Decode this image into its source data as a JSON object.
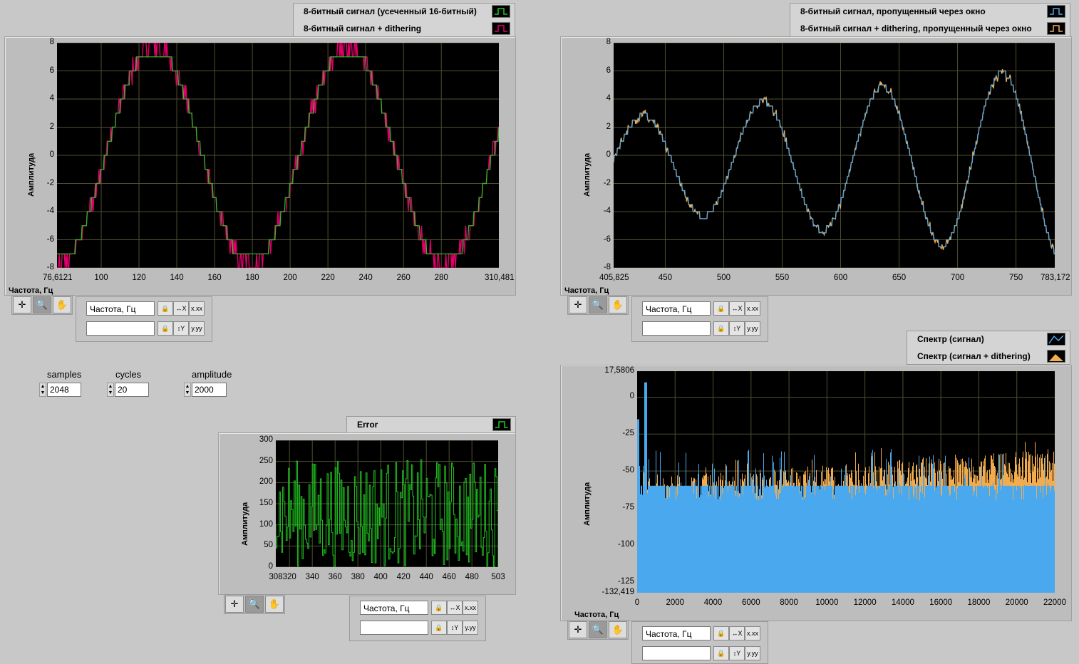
{
  "colors": {
    "dig8": "#22c522",
    "dither": "#e0006a",
    "win": "#4aa8ee",
    "win_dither": "#f2ac4e",
    "err": "#22c522",
    "grid": "#4f4f33"
  },
  "icons": [
    "crosshair-icon",
    "zoom-icon",
    "hand-icon",
    "lock-icon",
    "autoscale-x-icon",
    "format-x-icon",
    "autoscale-y-icon",
    "format-y-icon"
  ],
  "legends": {
    "topleft": [
      "8-битный сигнал (усеченный 16-битный)",
      "8-битный сигнал + dithering"
    ],
    "topright": [
      "8-битный сигнал, пропущенный через окно",
      "8-битный сигнал + dithering, пропущенный через окно"
    ],
    "spectrum": [
      "Спектр (сигнал)",
      "Спектр (сигнал + dithering)"
    ],
    "error": [
      "Error"
    ]
  },
  "axes": {
    "ylabel": "Амплитуда",
    "xlabel": "Частота, Гц",
    "tl_x": [
      "76,6121",
      "100",
      "120",
      "140",
      "160",
      "180",
      "200",
      "220",
      "240",
      "260",
      "280",
      "310,481"
    ],
    "tl_y": [
      "8",
      "6",
      "4",
      "2",
      "0",
      "-2",
      "-4",
      "-6",
      "-8"
    ],
    "tr_x": [
      "405,825",
      "450",
      "500",
      "550",
      "600",
      "650",
      "700",
      "750",
      "783,172"
    ],
    "tr_y": [
      "8",
      "6",
      "4",
      "2",
      "0",
      "-2",
      "-4",
      "-6",
      "-8"
    ],
    "err_x": [
      "308",
      "320",
      "340",
      "360",
      "380",
      "400",
      "420",
      "440",
      "460",
      "480",
      "503"
    ],
    "err_y": [
      "300",
      "250",
      "200",
      "150",
      "100",
      "50",
      "0"
    ],
    "sp_x": [
      "0",
      "2000",
      "4000",
      "6000",
      "8000",
      "10000",
      "12000",
      "14000",
      "16000",
      "18000",
      "20000",
      "22000"
    ],
    "sp_y": [
      "17,5806",
      "0",
      "-25",
      "-50",
      "-75",
      "-100",
      "-125",
      "-132,419"
    ]
  },
  "scale_legends": {
    "tl": {
      "x": "Частота, Гц",
      "y": ""
    },
    "tr": {
      "x": "Частота, Гц",
      "y": ""
    },
    "err": {
      "x": "Частота, Гц",
      "y": ""
    },
    "sp": {
      "x": "Частота, Гц",
      "y": ""
    }
  },
  "scale_buttons": {
    "lock": "🔒",
    "autox": "↔X",
    "fmtx": "x.xx",
    "autoy": "↕Y",
    "fmty": "y.yy"
  },
  "palette_glyphs": {
    "cross": "✛",
    "zoom": "🔍",
    "hand": "✋"
  },
  "controls": {
    "samples": {
      "label": "samples",
      "value": "2048"
    },
    "cycles": {
      "label": "cycles",
      "value": "20"
    },
    "amplitude": {
      "label": "amplitude",
      "value": "2000"
    }
  },
  "chart_data": [
    {
      "type": "line",
      "xlabel": "Частота, Гц",
      "ylabel": "Амплитуда",
      "xlim": [
        76.6121,
        310.481
      ],
      "ylim": [
        -8,
        8
      ],
      "series": [
        {
          "name": "8-битный сигнал (усеченный 16-битный)",
          "kind": "quantized sine",
          "period": 102.4,
          "amplitude": 7.8,
          "phase_x": 102.4
        },
        {
          "name": "8-битный сигнал + dithering",
          "kind": "dithered quantized sine",
          "period": 102.4,
          "amplitude": 7.8,
          "phase_x": 102.4
        }
      ]
    },
    {
      "type": "line",
      "xlabel": "Частота, Гц",
      "ylabel": "Амплитуда",
      "xlim": [
        405.825,
        783.172
      ],
      "ylim": [
        -8,
        8
      ],
      "series": [
        {
          "name": "8-битный сигнал, пропущенный через окно",
          "kind": "windowed quantized sine",
          "period": 102.4,
          "peaks": [
            3.2,
            4.4,
            5.5,
            6.5
          ],
          "troughs": [
            -4.0,
            -5.0,
            -6.1
          ]
        },
        {
          "name": "8-битный сигнал + dithering, пропущенный через окно",
          "kind": "windowed dithered quantized sine",
          "period": 102.4
        }
      ]
    },
    {
      "type": "line",
      "xlabel": "Частота, Гц",
      "ylabel": "Амплитуда",
      "xlim": [
        308,
        503
      ],
      "ylim": [
        0,
        300
      ],
      "series": [
        {
          "name": "Error",
          "kind": "random noise",
          "min": 0,
          "max": 255
        }
      ]
    },
    {
      "type": "area",
      "xlabel": "Частота, Гц",
      "ylabel": "Амплитуда",
      "xlim": [
        0,
        22000
      ],
      "ylim": [
        -132.419,
        17.5806
      ],
      "series": [
        {
          "name": "Спектр (сигнал)",
          "peak": {
            "x": 430,
            "y": 10
          },
          "noise_floor": -60
        },
        {
          "name": "Спектр (сигнал + dithering)",
          "noise_floor_start": -55,
          "noise_floor_end": -35
        }
      ]
    }
  ]
}
